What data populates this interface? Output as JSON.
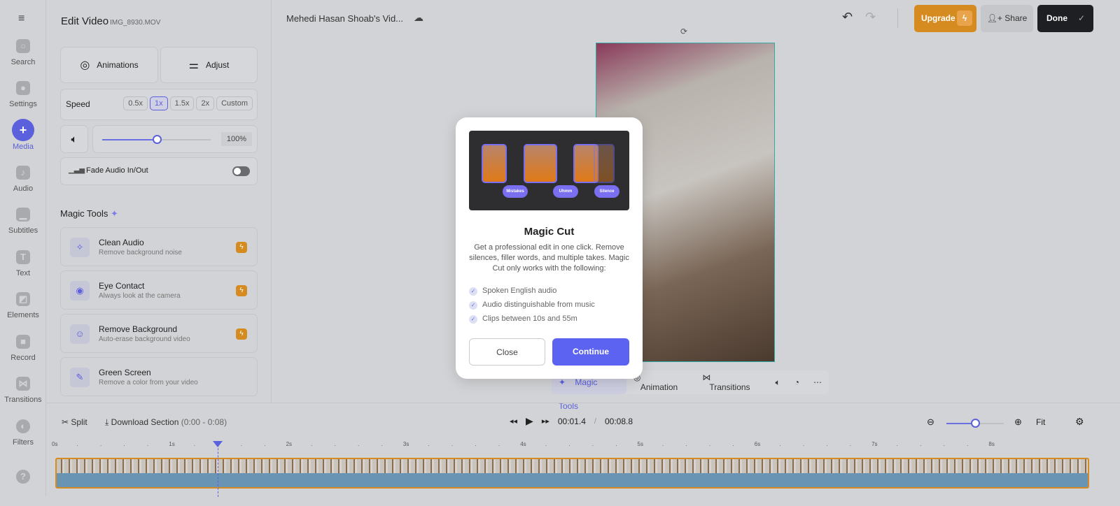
{
  "rail": {
    "items": [
      {
        "label": "Search",
        "icon": "search-icon"
      },
      {
        "label": "Settings",
        "icon": "gear-icon"
      },
      {
        "label": "Media",
        "icon": "plus-icon"
      },
      {
        "label": "Audio",
        "icon": "music-icon"
      },
      {
        "label": "Subtitles",
        "icon": "subtitles-icon"
      },
      {
        "label": "Text",
        "icon": "text-icon"
      },
      {
        "label": "Elements",
        "icon": "elements-icon"
      },
      {
        "label": "Record",
        "icon": "record-icon"
      },
      {
        "label": "Transitions",
        "icon": "transitions-icon"
      },
      {
        "label": "Filters",
        "icon": "filters-icon"
      }
    ],
    "help": "?"
  },
  "panel": {
    "title": "Edit Video",
    "filename": "IMG_8930.MOV",
    "animations": "Animations",
    "adjust": "Adjust",
    "speed_label": "Speed",
    "speeds": [
      "0.5x",
      "1x",
      "1.5x",
      "2x",
      "Custom"
    ],
    "selected_speed": "1x",
    "volume": "100%",
    "volume_fraction": 0.5,
    "fade": "Fade Audio In/Out",
    "magic_title": "Magic Tools",
    "tools": [
      {
        "title": "Clean Audio",
        "sub": "Remove background noise",
        "icon": "✧"
      },
      {
        "title": "Eye Contact",
        "sub": "Always look at the camera",
        "icon": "◉"
      },
      {
        "title": "Remove Background",
        "sub": "Auto-erase background video",
        "icon": "☺"
      },
      {
        "title": "Green Screen",
        "sub": "Remove a color from your video",
        "icon": "✎"
      }
    ]
  },
  "header": {
    "project": "Mehedi Hasan Shoab's Vid...",
    "upgrade": "Upgrade",
    "share": "Share",
    "done": "Done"
  },
  "video_toolbar": {
    "magic": "Magic Tools",
    "animation": "Animation",
    "transitions": "Transitions"
  },
  "modal": {
    "pills": [
      "Mistakes",
      "Uhmm",
      "Silence"
    ],
    "title": "Magic Cut",
    "desc": "Get a professional edit in one click. Remove silences, filler words, and multiple takes. Magic Cut only works with the following:",
    "checks": [
      "Spoken English audio",
      "Audio distinguishable from music",
      "Clips between 10s and 55m"
    ],
    "close": "Close",
    "continue": "Continue"
  },
  "timeline": {
    "split": "Split",
    "download": "Download Section",
    "range": "(0:00 - 0:08)",
    "current": "00:01.4",
    "sep": "/",
    "total": "00:08.8",
    "fit": "Fit",
    "ticks": [
      "0s",
      "1s",
      "2s",
      "3s",
      "4s",
      "5s",
      "6s",
      "7s",
      "8s"
    ],
    "zoom_fraction": 0.5
  },
  "colors": {
    "accent": "#5b60dc",
    "upgrade": "#d68b20",
    "done": "#1e1f22"
  }
}
